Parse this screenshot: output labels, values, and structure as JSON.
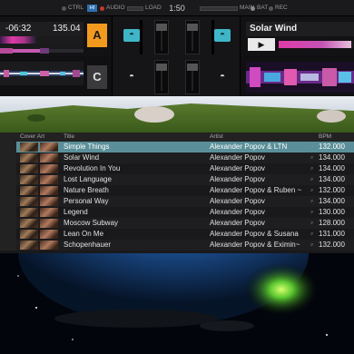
{
  "topbar": {
    "ctrl_label": "CTRL",
    "hid_label": "HI",
    "audio_label": "AUDIO",
    "load_label": "LOAD",
    "time": "1:50",
    "main_label": "MAIN",
    "bat_label": "BAT",
    "rec_label": "REC"
  },
  "deck_a": {
    "time": "-06:32",
    "bpm": "135.04",
    "letter": "A"
  },
  "deck_b": {
    "title": "Solar Wind",
    "play_symbol": "▶"
  },
  "deck_c": {
    "letter": "C"
  },
  "browser": {
    "columns": [
      "Cover Art",
      "Title",
      "Artist",
      "BPM"
    ],
    "tracks": [
      {
        "title": "Simple Things",
        "artist": "Alexander Popov & LTN",
        "bpm": "132.000"
      },
      {
        "title": "Solar Wind",
        "artist": "Alexander Popov",
        "bpm": "134.000"
      },
      {
        "title": "Revolution In You",
        "artist": "Alexander Popov",
        "bpm": "134.000"
      },
      {
        "title": "Lost Language",
        "artist": "Alexander Popov",
        "bpm": "134.000"
      },
      {
        "title": "Nature Breath",
        "artist": "Alexander Popov & Ruben ~",
        "bpm": "132.000"
      },
      {
        "title": "Personal Way",
        "artist": "Alexander Popov",
        "bpm": "134.000"
      },
      {
        "title": "Legend",
        "artist": "Alexander Popov",
        "bpm": "130.000"
      },
      {
        "title": "Moscow Subway",
        "artist": "Alexander Popov",
        "bpm": "128.000"
      },
      {
        "title": "Lean On Me",
        "artist": "Alexander Popov & Susana",
        "bpm": "131.000"
      },
      {
        "title": "Schopenhauer",
        "artist": "Alexander Popov & Eximin~",
        "bpm": "132.000"
      }
    ]
  },
  "colors": {
    "accent_orange": "#f39a1e",
    "headphone_cyan": "#3fb6c7",
    "selected_row": "#5a8f99"
  }
}
